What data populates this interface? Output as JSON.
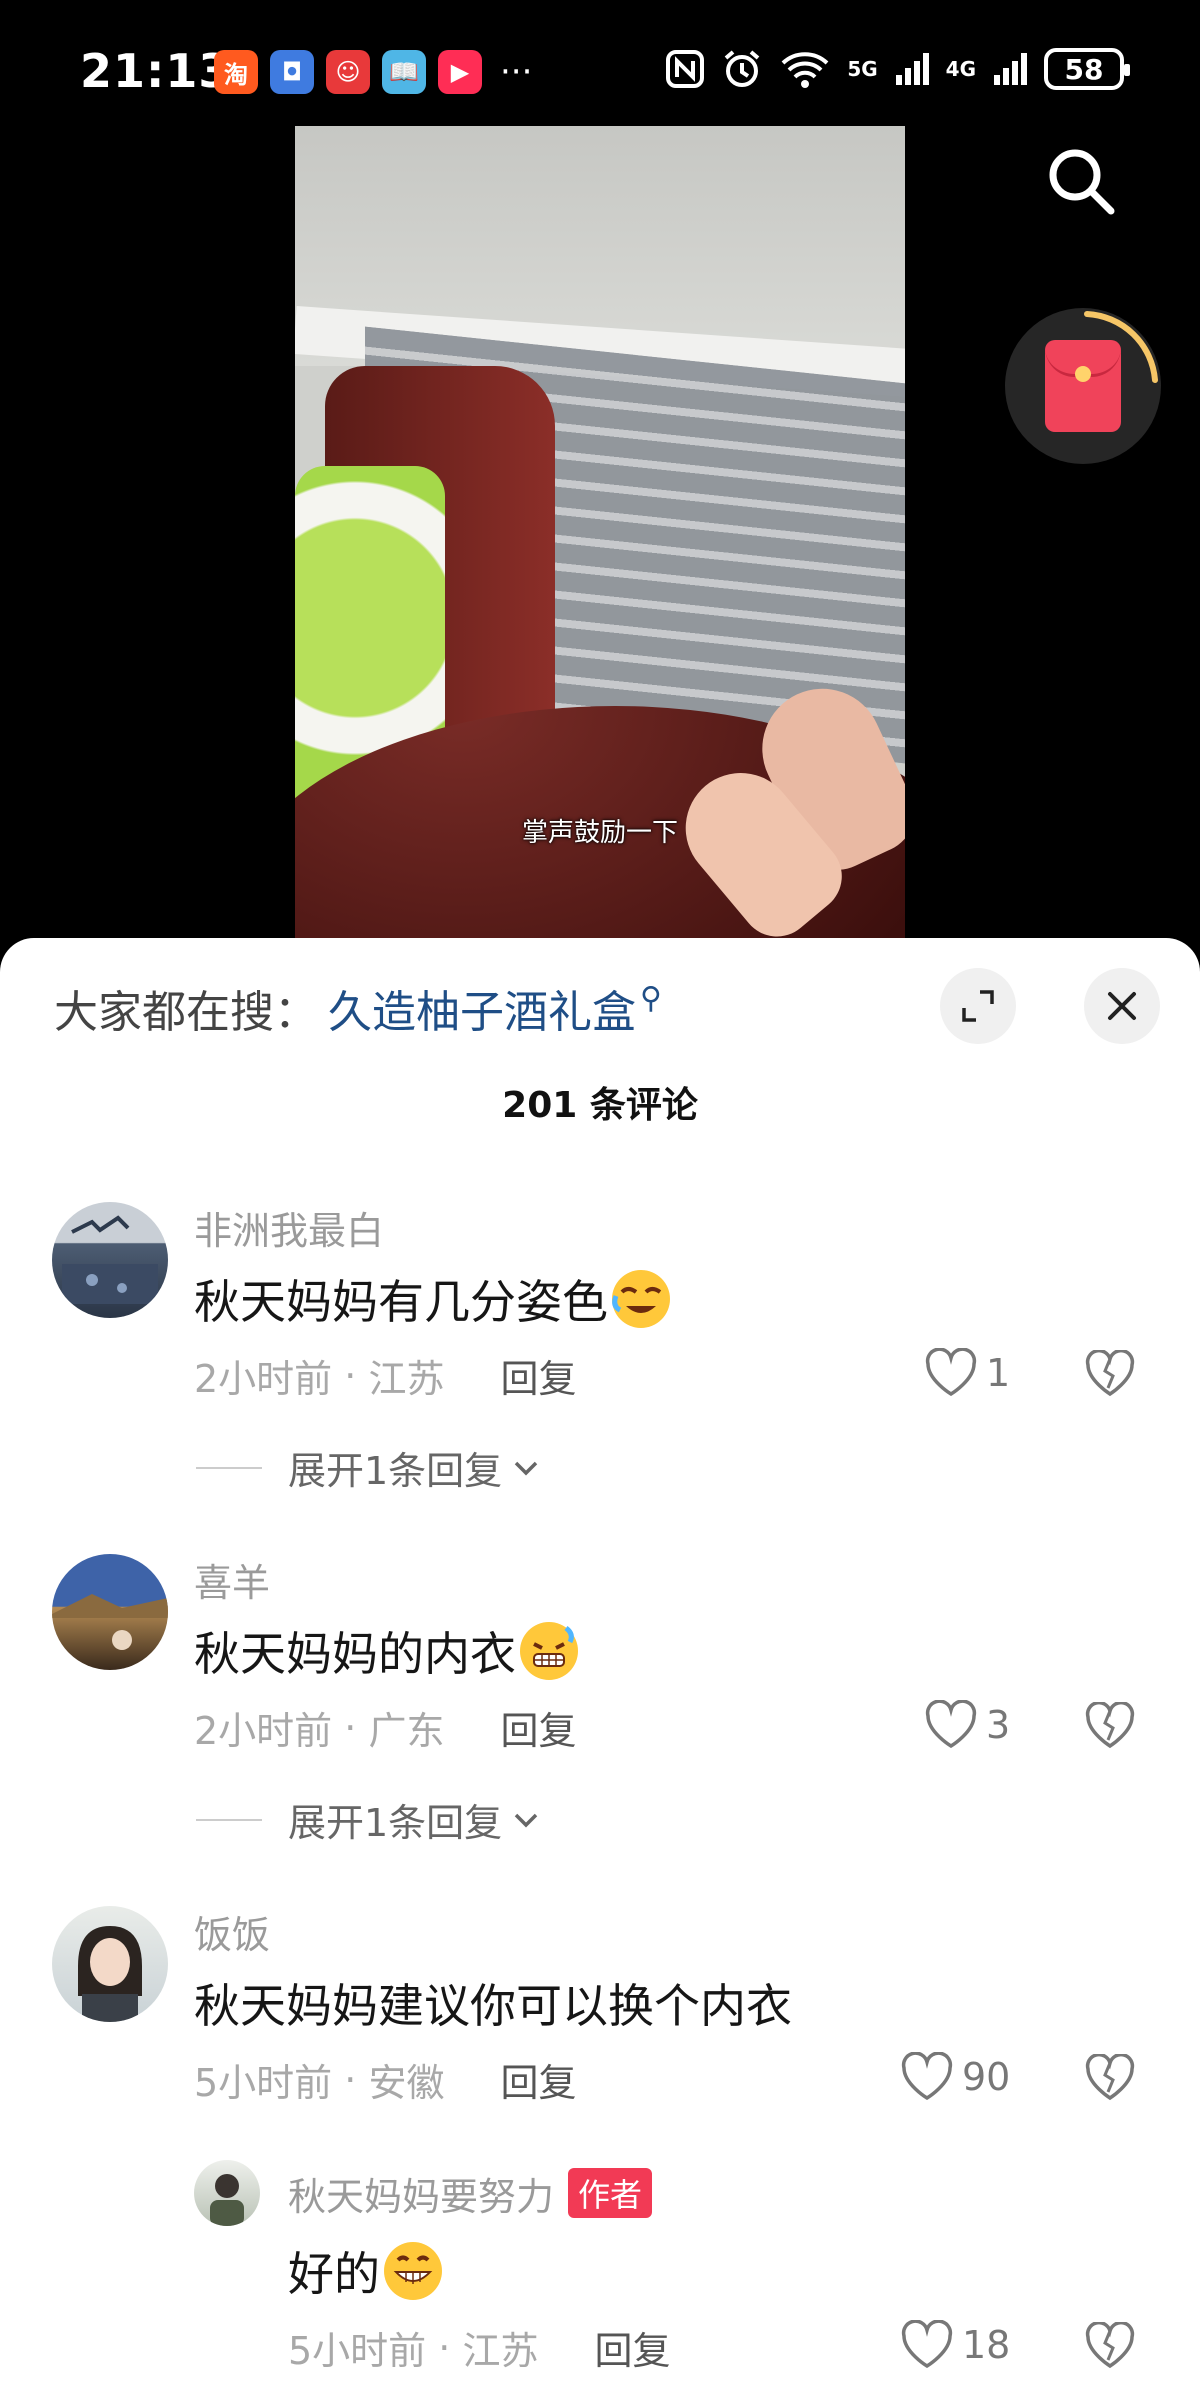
{
  "status_bar": {
    "time": "21:13",
    "apps": [
      {
        "icon": "taobao-icon",
        "glyph": "淘",
        "color": "#ff5a1f"
      },
      {
        "icon": "app-blue-icon",
        "glyph": "◘",
        "color": "#3f7be0"
      },
      {
        "icon": "app-red-icon",
        "glyph": "☺",
        "color": "#e8393a"
      },
      {
        "icon": "book-icon",
        "glyph": "📖",
        "color": "#4fb6e6"
      },
      {
        "icon": "video-play-icon",
        "glyph": "▶",
        "color": "#ff2d55"
      }
    ],
    "more": "···",
    "signal_5g": "5G",
    "signal_4g": "4G",
    "wifi_label": "6",
    "battery": "58"
  },
  "video": {
    "caption": "掌声鼓励一下"
  },
  "sheet": {
    "trend_prefix": "大家都在搜：",
    "trend_keyword": "久造柚子酒礼盒",
    "comment_count": "201 条评论",
    "expand_replies_label": "展开1条回复",
    "reply_label": "回复",
    "author_tag": "作者"
  },
  "comments": [
    {
      "user": "非洲我最白",
      "text": "秋天妈妈有几分姿色",
      "emoji": "laughing-tears-emoji",
      "time": "2小时前",
      "location": "江苏",
      "likes": "1"
    },
    {
      "user": "喜羊",
      "text": "秋天妈妈的内衣",
      "emoji": "grimace-emoji",
      "time": "2小时前",
      "location": "广东",
      "likes": "3"
    },
    {
      "user": "饭饭",
      "text": "秋天妈妈建议你可以换个内衣",
      "time": "5小时前",
      "location": "安徽",
      "likes": "90"
    }
  ],
  "reply": {
    "user": "秋天妈妈要努力",
    "text": "好的",
    "emoji": "grin-emoji",
    "time": "5小时前",
    "location": "江苏",
    "likes": "18"
  },
  "colors": {
    "accent_link": "#1f4e86",
    "author_tag": "#f23a55",
    "redpacket": "#f0435a"
  }
}
